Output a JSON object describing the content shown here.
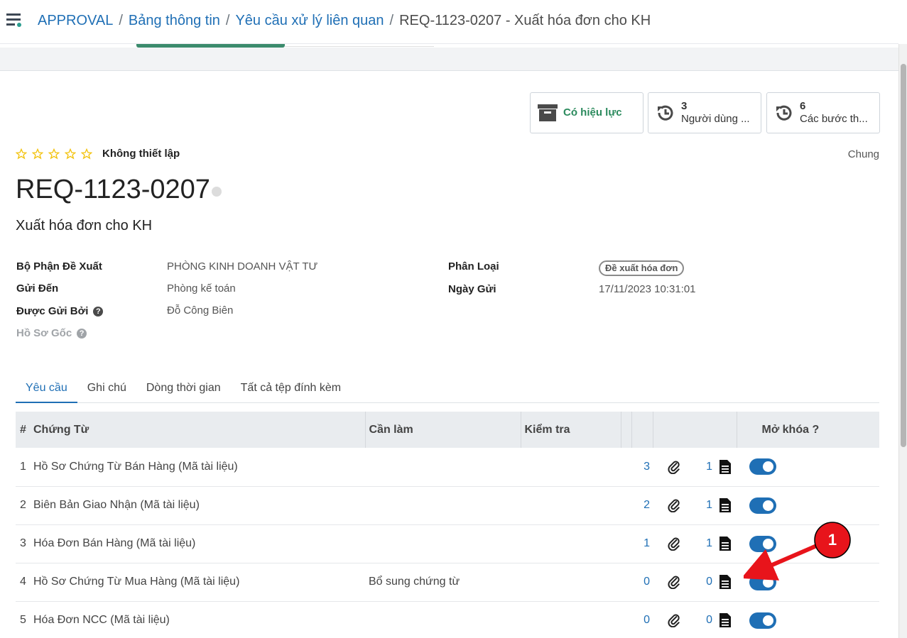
{
  "breadcrumb": {
    "items": [
      "APPROVAL",
      "Bảng thông tin",
      "Yêu cầu xử lý liên quan"
    ],
    "current": "REQ-1123-0207 - Xuất hóa đơn cho KH"
  },
  "smart_buttons": {
    "active": {
      "label": "Có hiệu lực",
      "icon": "archive-icon"
    },
    "users": {
      "count": "3",
      "label": "Người dùng ...",
      "icon": "history-icon"
    },
    "steps": {
      "count": "6",
      "label": "Các bước th...",
      "icon": "history-icon"
    }
  },
  "priority": {
    "stars": 5,
    "selected": 0,
    "label": "Không thiết lập"
  },
  "company": "Chung",
  "record": {
    "title": "REQ-1123-0207",
    "subtitle": "Xuất hóa đơn cho KH"
  },
  "fields": {
    "department_label": "Bộ Phận Đề Xuất",
    "department_value": "PHÒNG KINH DOANH VẬT TƯ",
    "send_to_label": "Gửi Đến",
    "send_to_value": "Phòng kế toán",
    "sent_by_label": "Được Gửi Bởi",
    "sent_by_value": "Đỗ Công Biên",
    "origin_label": "Hồ Sơ Gốc",
    "category_label": "Phân Loại",
    "category_value": "Đề xuất hóa đơn",
    "date_label": "Ngày Gửi",
    "date_value": "17/11/2023 10:31:01",
    "help_glyph": "?"
  },
  "tabs": [
    "Yêu cầu",
    "Ghi chú",
    "Dòng thời gian",
    "Tất cả tệp đính kèm"
  ],
  "table": {
    "headers": {
      "index": "#",
      "document": "Chứng Từ",
      "todo": "Cần làm",
      "check": "Kiểm tra",
      "unlock": "Mở khóa ?"
    },
    "rows": [
      {
        "index": "1",
        "document": "Hồ Sơ Chứng Từ Bán Hàng (Mã tài liệu)",
        "todo": "",
        "count1": "3",
        "count2": "1",
        "unlocked": true
      },
      {
        "index": "2",
        "document": "Biên Bản Giao Nhận (Mã tài liệu)",
        "todo": "",
        "count1": "2",
        "count2": "1",
        "unlocked": true
      },
      {
        "index": "3",
        "document": "Hóa Đơn Bán Hàng (Mã tài liệu)",
        "todo": "",
        "count1": "1",
        "count2": "1",
        "unlocked": true
      },
      {
        "index": "4",
        "document": "Hồ Sơ Chứng Từ Mua Hàng (Mã tài liệu)",
        "todo": "Bổ sung chứng từ",
        "count1": "0",
        "count2": "0",
        "unlocked": true
      },
      {
        "index": "5",
        "document": "Hóa Đơn NCC (Mã tài liệu)",
        "todo": "",
        "count1": "0",
        "count2": "0",
        "unlocked": true
      }
    ]
  },
  "annotation": {
    "label": "1",
    "color": "#e8141b"
  },
  "colors": {
    "link": "#1f6fb5",
    "active_green": "#2b8a5d",
    "toggle": "#1f6fb5",
    "star": "#f3c30f"
  }
}
